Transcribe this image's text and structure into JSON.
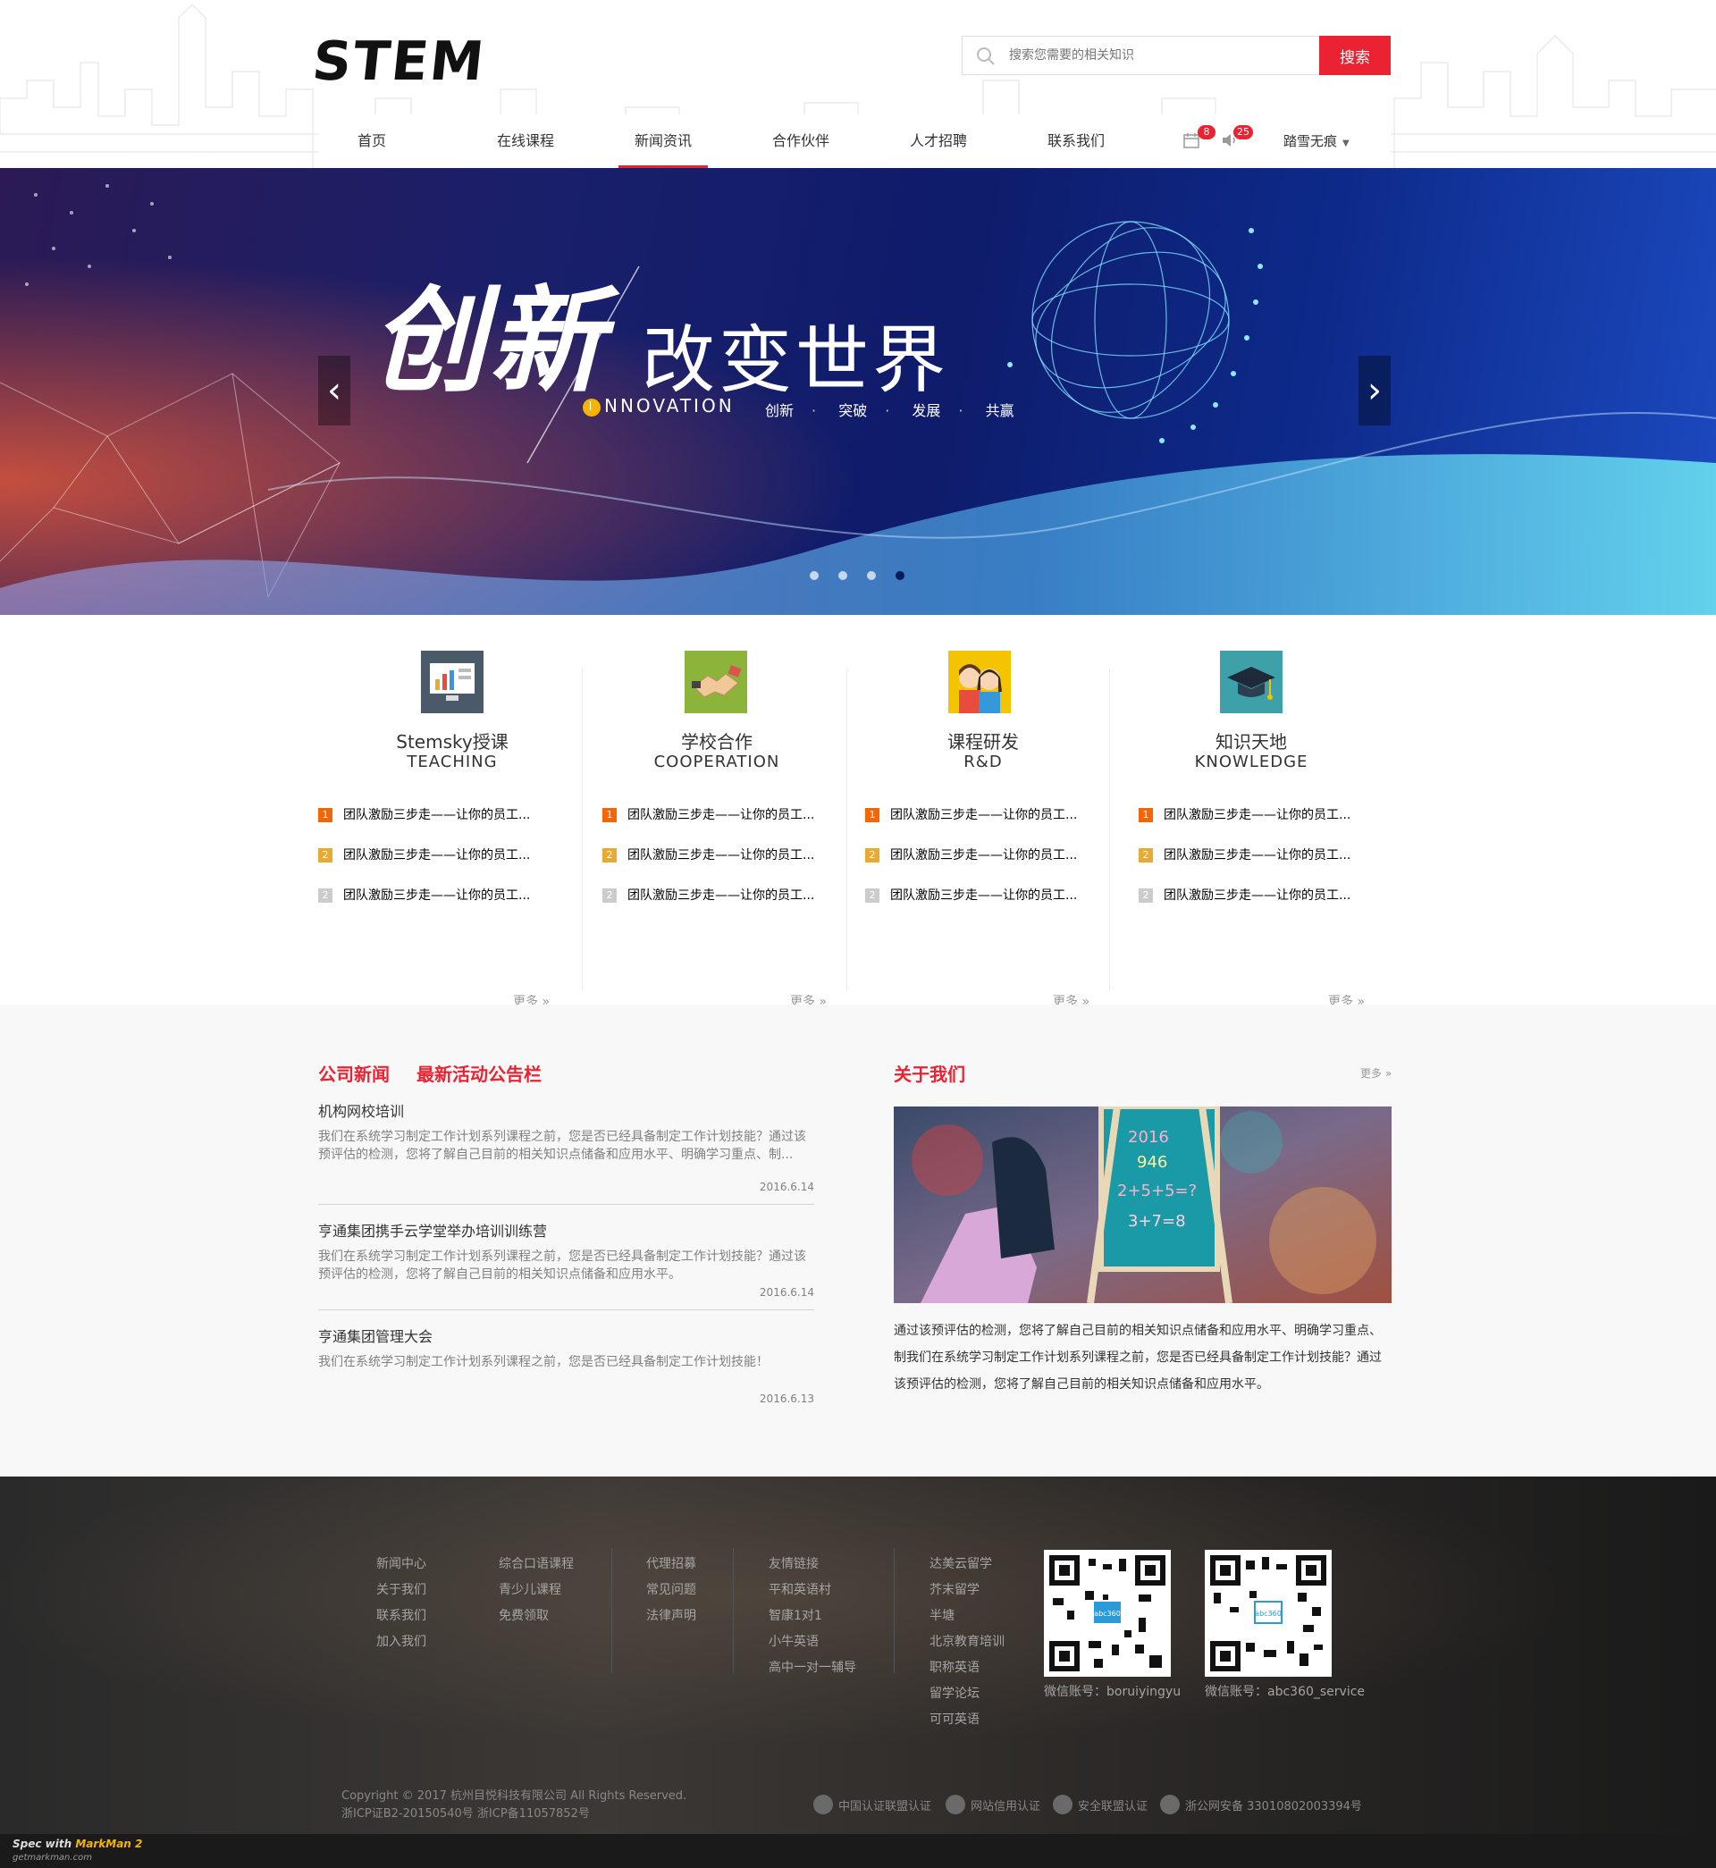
{
  "header": {
    "logo": "STEM",
    "search": {
      "placeholder": "搜索您需要的相关知识",
      "button": "搜索"
    },
    "nav": [
      {
        "label": "首页",
        "active": false
      },
      {
        "label": "在线课程",
        "active": false
      },
      {
        "label": "新闻资讯",
        "active": true
      },
      {
        "label": "合作伙伴",
        "active": false
      },
      {
        "label": "人才招聘",
        "active": false
      },
      {
        "label": "联系我们",
        "active": false
      }
    ],
    "calendar_badge": "8",
    "message_badge": "25",
    "user_name": "踏雪无痕",
    "accent_color": "#eb2232"
  },
  "banner": {
    "title_cn": "创新",
    "title_2": "改变世界",
    "subtitle_letter": "I",
    "subtitle": "NNOVATION",
    "tags": [
      "创新",
      "突破",
      "发展",
      "共赢"
    ],
    "dot_separator": "·",
    "prev": "‹",
    "next": "›",
    "slides": 4,
    "current_slide": 4
  },
  "features": [
    {
      "title": "Stemsky授课",
      "subtitle": "TEACHING",
      "icon": "monitor-chart-icon",
      "items": [
        "团队激励三步走——让你的员工...",
        "团队激励三步走——让你的员工...",
        "团队激励三步走——让你的员工..."
      ],
      "nums": [
        "1",
        "2",
        "2"
      ],
      "more": "更多 »"
    },
    {
      "title": "学校合作",
      "subtitle": "COOPERATION",
      "icon": "handshake-icon",
      "items": [
        "团队激励三步走——让你的员工...",
        "团队激励三步走——让你的员工...",
        "团队激励三步走——让你的员工..."
      ],
      "nums": [
        "1",
        "2",
        "2"
      ],
      "more": "更多 »"
    },
    {
      "title": "课程研发",
      "subtitle": "R&D",
      "icon": "students-icon",
      "items": [
        "团队激励三步走——让你的员工...",
        "团队激励三步走——让你的员工...",
        "团队激励三步走——让你的员工..."
      ],
      "nums": [
        "1",
        "2",
        "2"
      ],
      "more": "更多 »"
    },
    {
      "title": "知识天地",
      "subtitle": "KNOWLEDGE",
      "icon": "graduation-cap-icon",
      "items": [
        "团队激励三步走——让你的员工...",
        "团队激励三步走——让你的员工...",
        "团队激励三步走——让你的员工..."
      ],
      "nums": [
        "1",
        "2",
        "2"
      ],
      "more": "更多 »"
    }
  ],
  "news": {
    "tabs": [
      "公司新闻",
      "最新活动公告栏"
    ],
    "items": [
      {
        "title": "机构网校培训",
        "desc": "我们在系统学习制定工作计划系列课程之前，您是否已经具备制定工作计划技能？通过该预评估的检测，您将了解自己目前的相关知识点储备和应用水平、明确学习重点、制...",
        "date": "2016.6.14"
      },
      {
        "title": "亨通集团携手云学堂举办培训训练营",
        "desc": "我们在系统学习制定工作计划系列课程之前，您是否已经具备制定工作计划技能？通过该预评估的检测，您将了解自己目前的相关知识点储备和应用水平。",
        "date": "2016.6.14"
      },
      {
        "title": "亨通集团管理大会",
        "desc": "我们在系统学习制定工作计划系列课程之前，您是否已经具备制定工作计划技能！",
        "date": "2016.6.13"
      }
    ]
  },
  "about": {
    "title": "关于我们",
    "more": "更多 »",
    "text": "通过该预评估的检测，您将了解自己目前的相关知识点储备和应用水平、明确学习重点、制我们在系统学习制定工作计划系列课程之前，您是否已经具备制定工作计划技能？通过该预评估的检测，您将了解自己目前的相关知识点储备和应用水平。",
    "chalkboard": [
      "2016",
      "946",
      "2+5+5=?",
      "3+7=8"
    ]
  },
  "footer": {
    "col1": [
      "新闻中心",
      "关于我们",
      "联系我们",
      "加入我们"
    ],
    "col2": [
      "综合口语课程",
      "青少儿课程",
      "免费领取"
    ],
    "col3": [
      "代理招募",
      "常见问题",
      "法律声明"
    ],
    "col4": [
      "友情链接",
      "平和英语村",
      "智康1对1",
      "小牛英语",
      "高中一对一辅导"
    ],
    "col5": [
      "达美云留学",
      "芥末留学",
      "半塘",
      "北京教育培训",
      "职称英语",
      "留学论坛",
      "可可英语"
    ],
    "qr1_caption": "微信账号：boruiyingyu",
    "qr2_caption": "微信账号：abc360_service",
    "qr_center_label": "abc360",
    "copyright_1": "Copyright © 2017 杭州目悦科技有限公司 All Rights Reserved.",
    "copyright_2": "浙ICP证B2-20150540号 浙ICP备11057852号",
    "certs": [
      "中国认证联盟认证",
      "网站信用认证",
      "安全联盟认证",
      "浙公网安备 33010802003394号"
    ]
  },
  "markman": {
    "prefix": "Spec with ",
    "brand": "MarkMan 2",
    "site": "getmarkman.com"
  }
}
